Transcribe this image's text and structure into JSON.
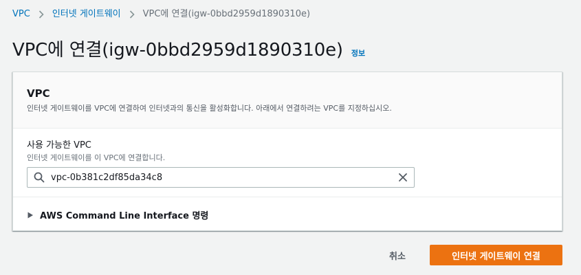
{
  "breadcrumb": {
    "items": [
      {
        "label": "VPC"
      },
      {
        "label": "인터넷 게이트웨이"
      },
      {
        "label": "VPC에 연결(igw-0bbd2959d1890310e)"
      }
    ]
  },
  "page": {
    "title": "VPC에 연결(igw-0bbd2959d1890310e)",
    "info_label": "정보"
  },
  "panel": {
    "title": "VPC",
    "description": "인터넷 게이트웨이를 VPC에 연결하여 인터넷과의 통신을 활성화합니다. 아래에서 연결하려는 VPC를 지정하십시오.",
    "field": {
      "label": "사용 가능한 VPC",
      "hint": "인터넷 게이트웨이를 이 VPC에 연결합니다.",
      "value": "vpc-0b381c2df85da34c8"
    },
    "cli_label": "AWS Command Line Interface 명령"
  },
  "actions": {
    "cancel_label": "취소",
    "submit_label": "인터넷 게이트웨이 연결"
  },
  "icons": {
    "separator": "chevron-right-icon",
    "search": "search-icon",
    "clear": "close-icon",
    "expand": "caret-right-icon"
  },
  "colors": {
    "link": "#0073bb",
    "primary_button": "#ec7211",
    "background": "#f2f3f3"
  }
}
